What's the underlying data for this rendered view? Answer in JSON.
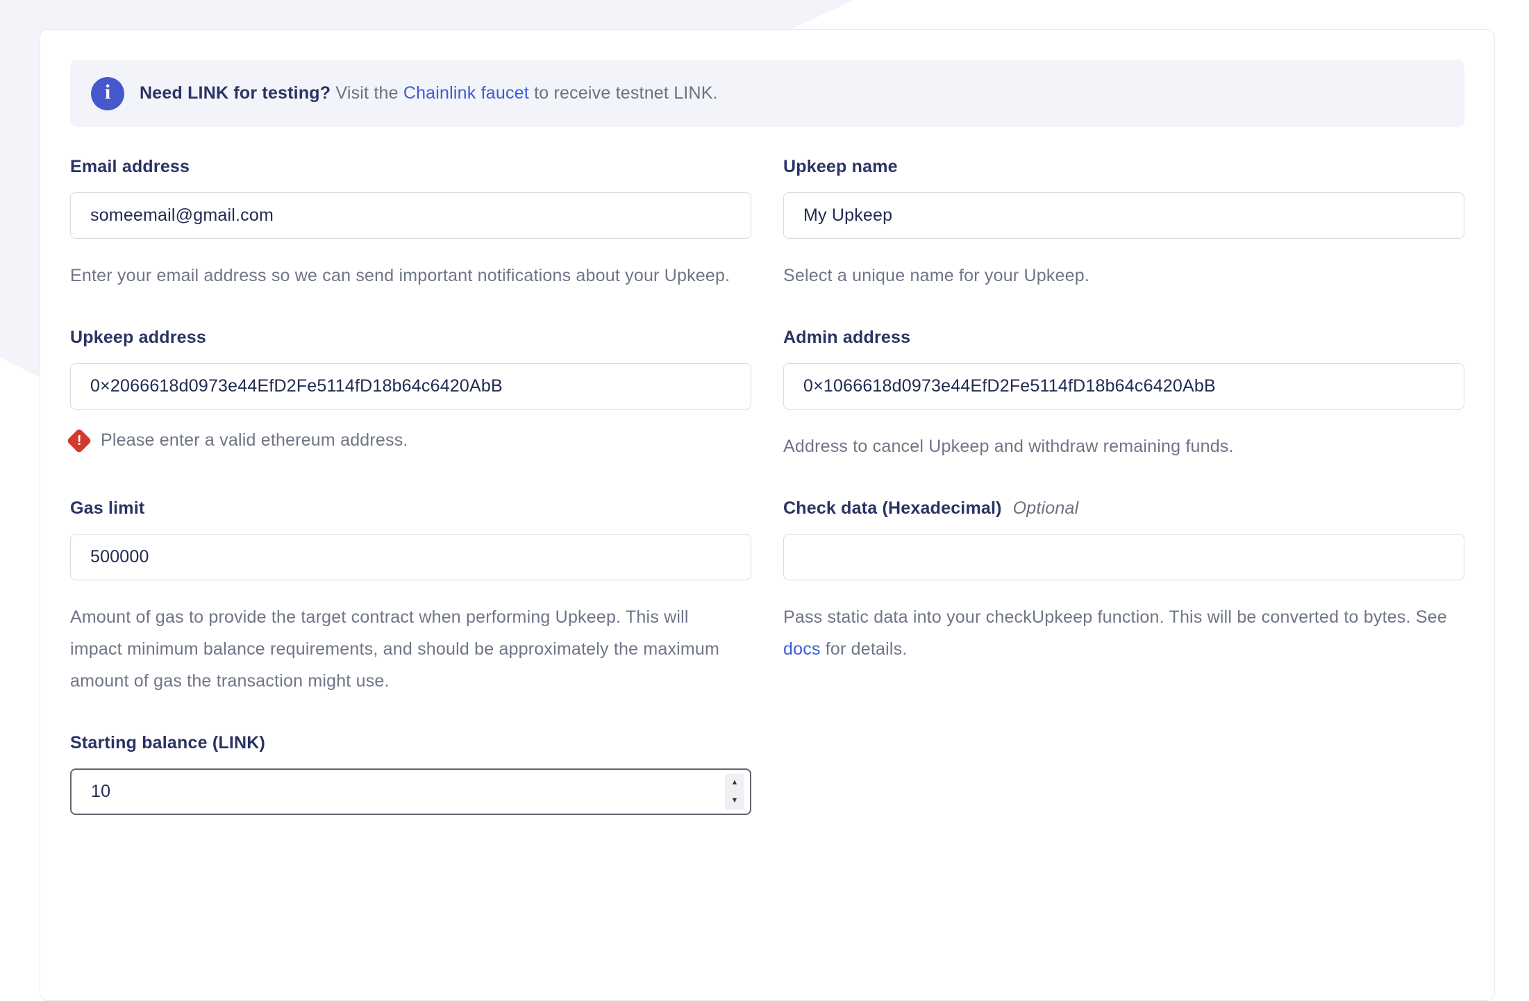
{
  "colors": {
    "background_band": "#f3f4f9",
    "card_border": "#e9ebf1",
    "label_navy": "#2a3364",
    "helper_gray": "#6e7586",
    "link_blue": "#3a5cd8",
    "info_icon_blue": "#4757cd",
    "error_red": "#d23a2e",
    "input_border": "#d8dbe3"
  },
  "icons": {
    "info_glyph": "i",
    "error_glyph": "!",
    "spinner_up": "▲",
    "spinner_down": "▼"
  },
  "banner": {
    "bold_text": "Need LINK for testing?",
    "regular_prefix": " Visit the ",
    "link_text": "Chainlink faucet",
    "regular_suffix": " to receive testnet LINK."
  },
  "fields": {
    "email": {
      "label": "Email address",
      "value": "someemail@gmail.com",
      "helper": "Enter your email address so we can send important notifications about your Upkeep."
    },
    "upkeep_name": {
      "label": "Upkeep name",
      "value": "My Upkeep",
      "helper": "Select a unique name for your Upkeep."
    },
    "upkeep_address": {
      "label": "Upkeep address",
      "value": "0×2066618d0973e44EfD2Fe5114fD18b64c6420AbB",
      "error": "Please enter a valid ethereum address."
    },
    "admin_address": {
      "label": "Admin address",
      "value": "0×1066618d0973e44EfD2Fe5114fD18b64c6420AbB",
      "helper": "Address to cancel Upkeep and withdraw remaining funds."
    },
    "gas_limit": {
      "label": "Gas limit",
      "value": "500000",
      "helper": "Amount of gas to provide the target contract when performing Upkeep. This will impact minimum balance requirements, and should be approximately the maximum amount of gas the transaction might use."
    },
    "check_data": {
      "label": "Check data (Hexadecimal)",
      "optional_label": "Optional",
      "value": "",
      "helper_prefix": "Pass static data into your checkUpkeep function. This will be converted to bytes. See ",
      "helper_link": "docs",
      "helper_suffix": " for details."
    },
    "starting_balance": {
      "label": "Starting balance (LINK)",
      "value": "10"
    }
  }
}
